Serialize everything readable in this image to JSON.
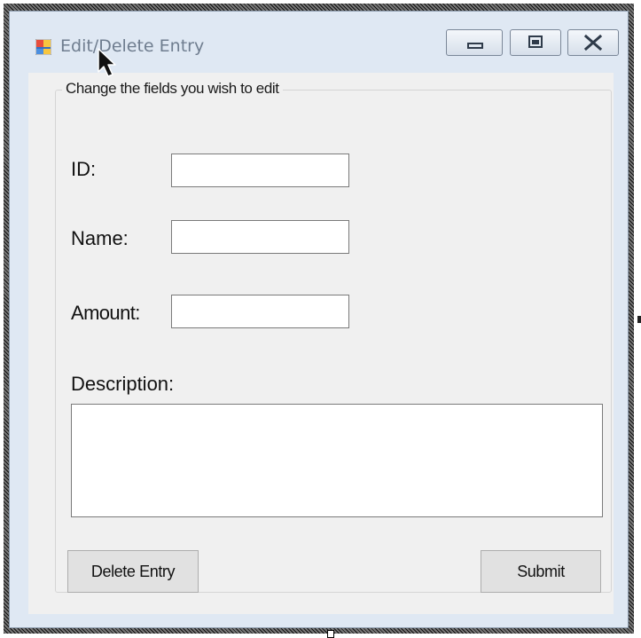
{
  "window": {
    "title": "Edit/Delete Entry",
    "icon": "winforms-app-icon",
    "caption_buttons": [
      "minimize-icon",
      "maximize-icon",
      "close-icon"
    ]
  },
  "form": {
    "group_caption": "Change the fields you wish to edit",
    "fields": {
      "id_label": "ID:",
      "id_value": "",
      "name_label": "Name:",
      "name_value": "",
      "amount_label": "Amount:",
      "amount_value": "",
      "description_label": "Description:",
      "description_value": ""
    },
    "buttons": {
      "delete_label": "Delete Entry",
      "submit_label": "Submit"
    }
  },
  "colors": {
    "window_frame": "#dfe8f3",
    "client_background": "#f0f0f0",
    "button_face": "#e1e1e1",
    "title_text": "#6f7d8f"
  }
}
